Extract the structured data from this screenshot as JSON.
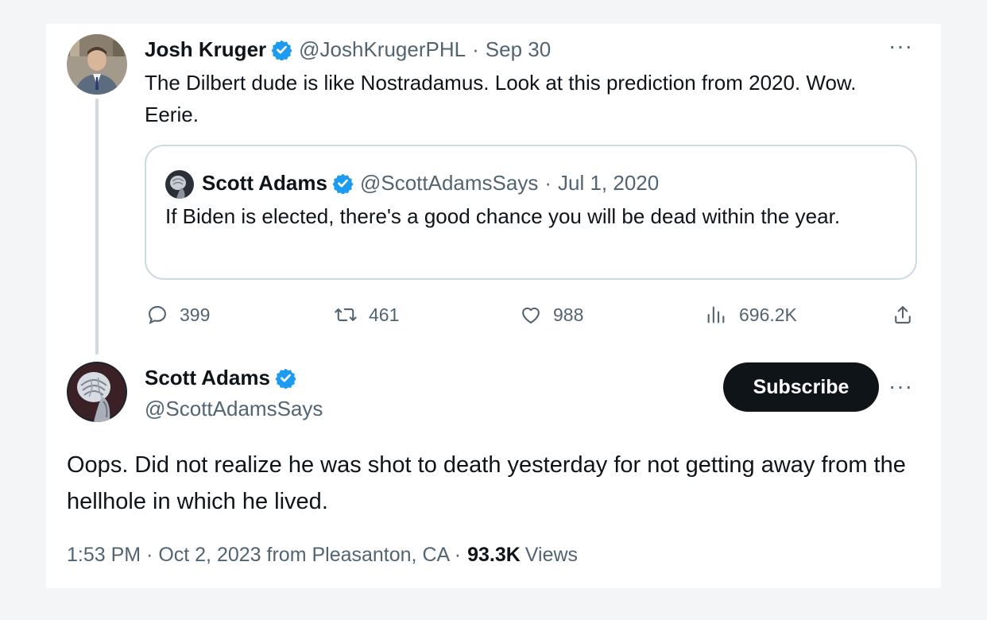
{
  "tweet1": {
    "author_name": "Josh Kruger",
    "author_handle": "@JoshKrugerPHL",
    "separator": "·",
    "date": "Sep 30",
    "text": "The Dilbert dude is like Nostradamus. Look at this prediction from 2020. Wow. Eerie.",
    "more_icon": "more-horizontal-icon",
    "more_label": "···"
  },
  "quoted": {
    "author_name": "Scott Adams",
    "author_handle": "@ScottAdamsSays",
    "separator": "·",
    "date": "Jul 1, 2020",
    "text": "If Biden is elected, there's a good chance you will be dead within the year."
  },
  "actions": {
    "replies": "399",
    "retweets": "461",
    "likes": "988",
    "views": "696.2K",
    "icons": [
      "reply-icon",
      "retweet-icon",
      "like-icon",
      "views-icon",
      "share-icon"
    ]
  },
  "tweet2": {
    "author_name": "Scott Adams",
    "author_handle": "@ScottAdamsSays",
    "subscribe_label": "Subscribe",
    "more_label": "···",
    "text": "Oops. Did not realize he was shot to death yesterday for not getting away from the hellhole in which he lived.",
    "timestamp": "1:53 PM · Oct 2, 2023 from Pleasanton, CA ·",
    "views_count": "93.3K",
    "views_label": "Views"
  },
  "colors": {
    "verified_blue": "#1d9bf0",
    "text_primary": "#0f1419",
    "text_secondary": "#536471",
    "border": "#cfd9de",
    "button_bg": "#0f1419"
  }
}
